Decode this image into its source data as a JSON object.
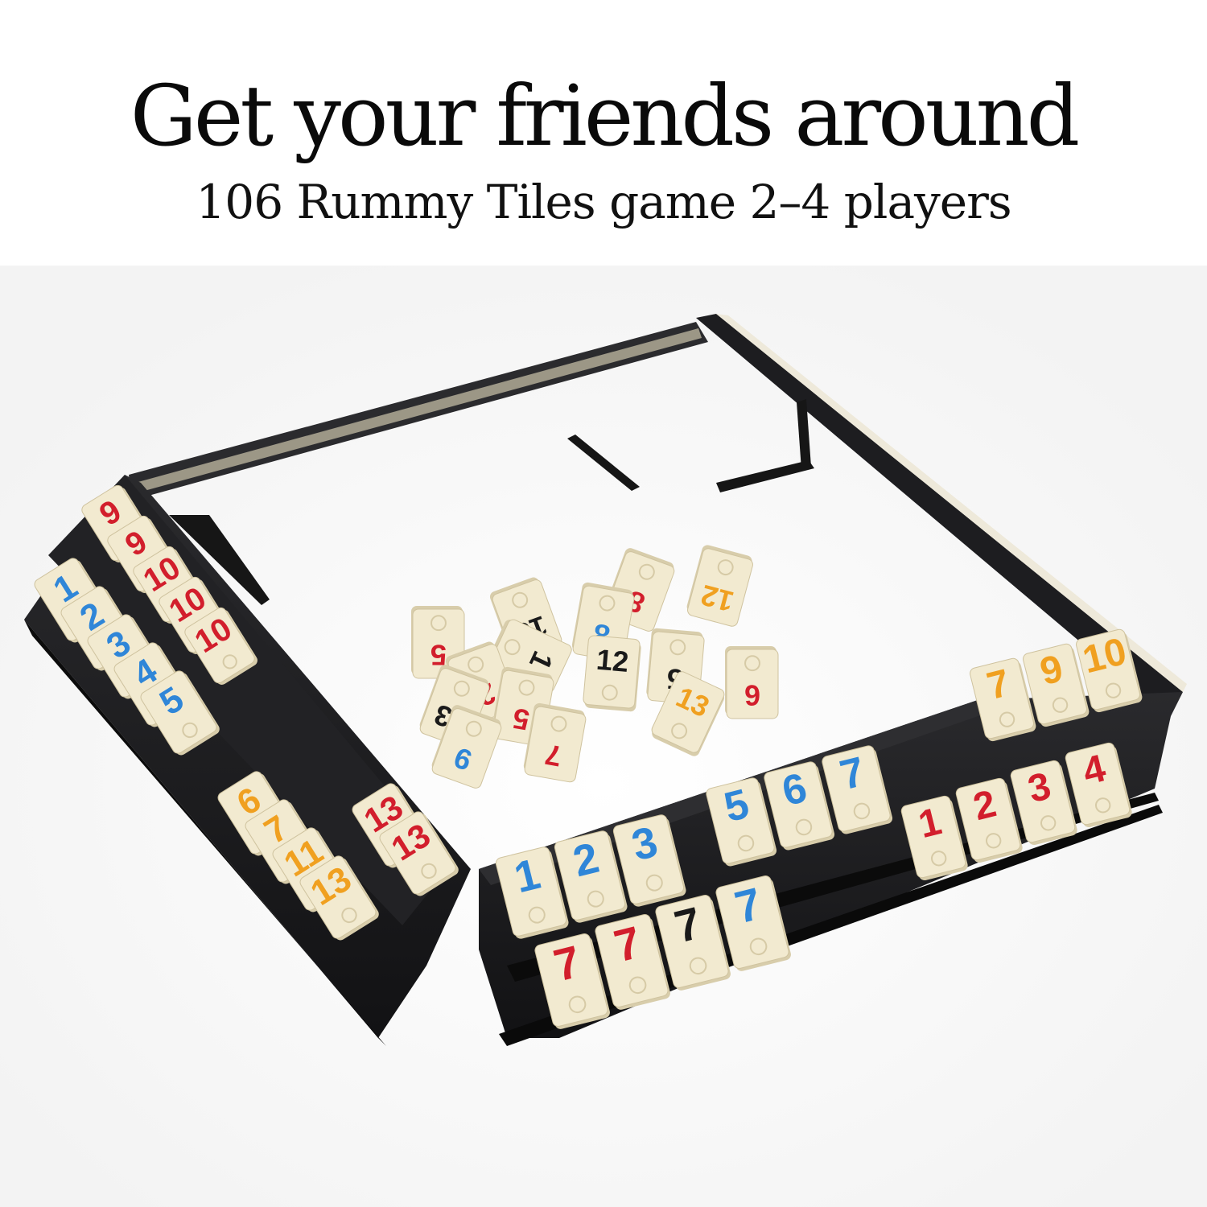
{
  "headline": "Get your friends around",
  "subheadline": "106  Rummy Tiles game 2–4 players",
  "colors": {
    "tile": "#f2ead0",
    "tile_edge": "#d8cdab",
    "rack": "#1c1c1e",
    "red": "#d21e2c",
    "blue": "#2f86d8",
    "orange": "#f0a020",
    "black": "#1a1a1a"
  },
  "left_rack": {
    "top_row": [
      {
        "n": "9",
        "c": "red"
      },
      {
        "n": "9",
        "c": "red"
      },
      {
        "n": "10",
        "c": "red"
      },
      {
        "n": "10",
        "c": "red"
      },
      {
        "n": "10",
        "c": "red"
      }
    ],
    "middle_row": [
      {
        "n": "1",
        "c": "blue"
      },
      {
        "n": "2",
        "c": "blue"
      },
      {
        "n": "3",
        "c": "blue"
      },
      {
        "n": "4",
        "c": "blue"
      },
      {
        "n": "5",
        "c": "blue"
      }
    ],
    "lower_row": [
      {
        "n": "6",
        "c": "orange"
      },
      {
        "n": "7",
        "c": "orange"
      },
      {
        "n": "11",
        "c": "orange"
      },
      {
        "n": "13",
        "c": "orange"
      }
    ],
    "pair": [
      {
        "n": "13",
        "c": "red"
      },
      {
        "n": "13",
        "c": "red"
      }
    ]
  },
  "front_rack": {
    "upper_right": [
      {
        "n": "7",
        "c": "orange"
      },
      {
        "n": "9",
        "c": "orange"
      },
      {
        "n": "10",
        "c": "orange"
      }
    ],
    "upper_middle": [
      {
        "n": "5",
        "c": "blue"
      },
      {
        "n": "6",
        "c": "blue"
      },
      {
        "n": "7",
        "c": "blue"
      }
    ],
    "upper_left": [
      {
        "n": "1",
        "c": "blue"
      },
      {
        "n": "2",
        "c": "blue"
      },
      {
        "n": "3",
        "c": "blue"
      }
    ],
    "lower_right": [
      {
        "n": "1",
        "c": "red"
      },
      {
        "n": "2",
        "c": "red"
      },
      {
        "n": "3",
        "c": "red"
      },
      {
        "n": "4",
        "c": "red"
      }
    ],
    "lower_left": [
      {
        "n": "7",
        "c": "red"
      },
      {
        "n": "7",
        "c": "red"
      },
      {
        "n": "7",
        "c": "black"
      },
      {
        "n": "7",
        "c": "blue"
      }
    ]
  },
  "scattered": [
    {
      "n": "13",
      "c": "black"
    },
    {
      "n": "8",
      "c": "red"
    },
    {
      "n": "12",
      "c": "orange"
    },
    {
      "n": "5",
      "c": "red"
    },
    {
      "n": "1",
      "c": "black"
    },
    {
      "n": "8",
      "c": "blue"
    },
    {
      "n": "2",
      "c": "red"
    },
    {
      "n": "12",
      "c": "black"
    },
    {
      "n": "5",
      "c": "black"
    },
    {
      "n": "6",
      "c": "red"
    },
    {
      "n": "13",
      "c": "black"
    },
    {
      "n": "5",
      "c": "red"
    },
    {
      "n": "13",
      "c": "orange"
    },
    {
      "n": "9",
      "c": "blue"
    },
    {
      "n": "7",
      "c": "red"
    }
  ]
}
